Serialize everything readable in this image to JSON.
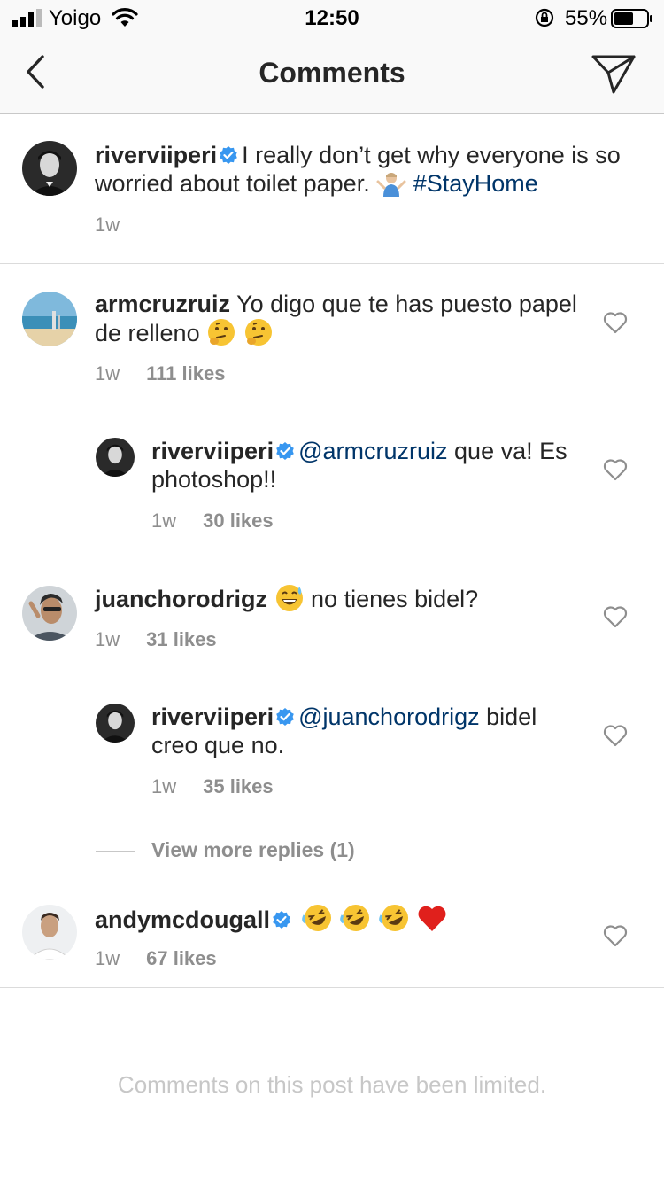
{
  "status_bar": {
    "carrier": "Yoigo",
    "time": "12:50",
    "battery_percent": "55%"
  },
  "nav": {
    "title": "Comments"
  },
  "caption": {
    "username": "riverviiperi",
    "text": "I really don’t get why everyone is so worried about toilet paper.",
    "hashtag": "#StayHome",
    "time": "1w"
  },
  "comments": [
    {
      "username": "armcruzruiz",
      "text": "Yo digo que te has puesto papel de relleno",
      "time": "1w",
      "likes": "111 likes"
    },
    {
      "username": "riverviiperi",
      "mention": "@armcruzruiz",
      "text": "que va! Es photoshop!!",
      "time": "1w",
      "likes": "30 likes"
    },
    {
      "username": "juanchorodrigz",
      "text": "no tienes bidel?",
      "time": "1w",
      "likes": "31 likes"
    },
    {
      "username": "riverviiperi",
      "mention": "@juanchorodrigz",
      "text": "bidel creo que no.",
      "time": "1w",
      "likes": "35 likes"
    },
    {
      "username": "andymcdougall",
      "time": "1w",
      "likes": "67 likes"
    }
  ],
  "view_more": "View more replies (1)",
  "footer": {
    "limited": "Comments on this post have been limited."
  },
  "colors": {
    "verified": "#3897f0",
    "link": "#003569",
    "meta": "#8e8e8e"
  }
}
